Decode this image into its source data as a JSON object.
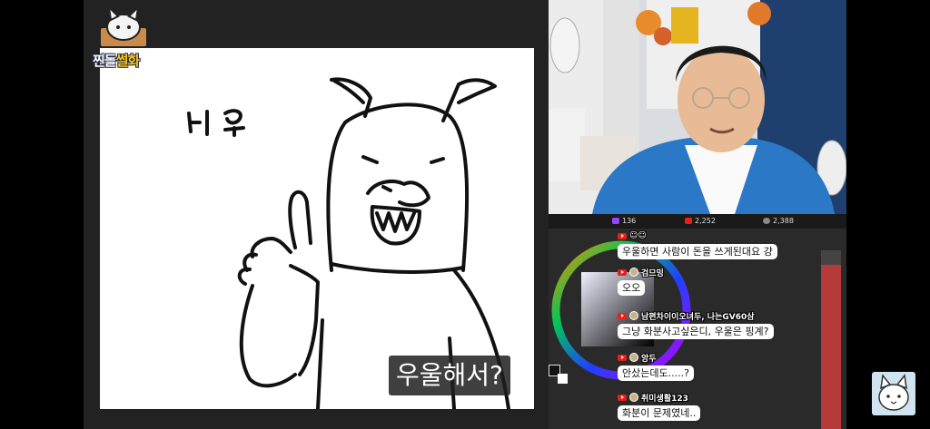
{
  "logo": {
    "line1": "찐돌",
    "line2": "썰화"
  },
  "drawing": {
    "handwriting": "나 유"
  },
  "subtitle": "우울해서?",
  "stats": {
    "chat_count": "136",
    "youtube_count": "2,252",
    "viewer_count": "2,388"
  },
  "chat": [
    {
      "name": "☺☺",
      "text": "우울하면 사람이 돈을 쓰게된대요 걍"
    },
    {
      "name": "검므밍",
      "text": "오오"
    },
    {
      "name": "남편차이이오녀두, 나는GV60삼",
      "text": "그냥 화분사고싶은디, 우울은 핑계?"
    },
    {
      "name": "앙두",
      "text": "안샀는데도.....?"
    },
    {
      "name": "취미생활123",
      "text": "화분이 문제였네.."
    }
  ],
  "colors": {
    "bubble": "#ffffff",
    "youtube_red": "#e62117",
    "hoodie_blue": "#2b78c6",
    "logo_yellow": "#f5c21a"
  }
}
